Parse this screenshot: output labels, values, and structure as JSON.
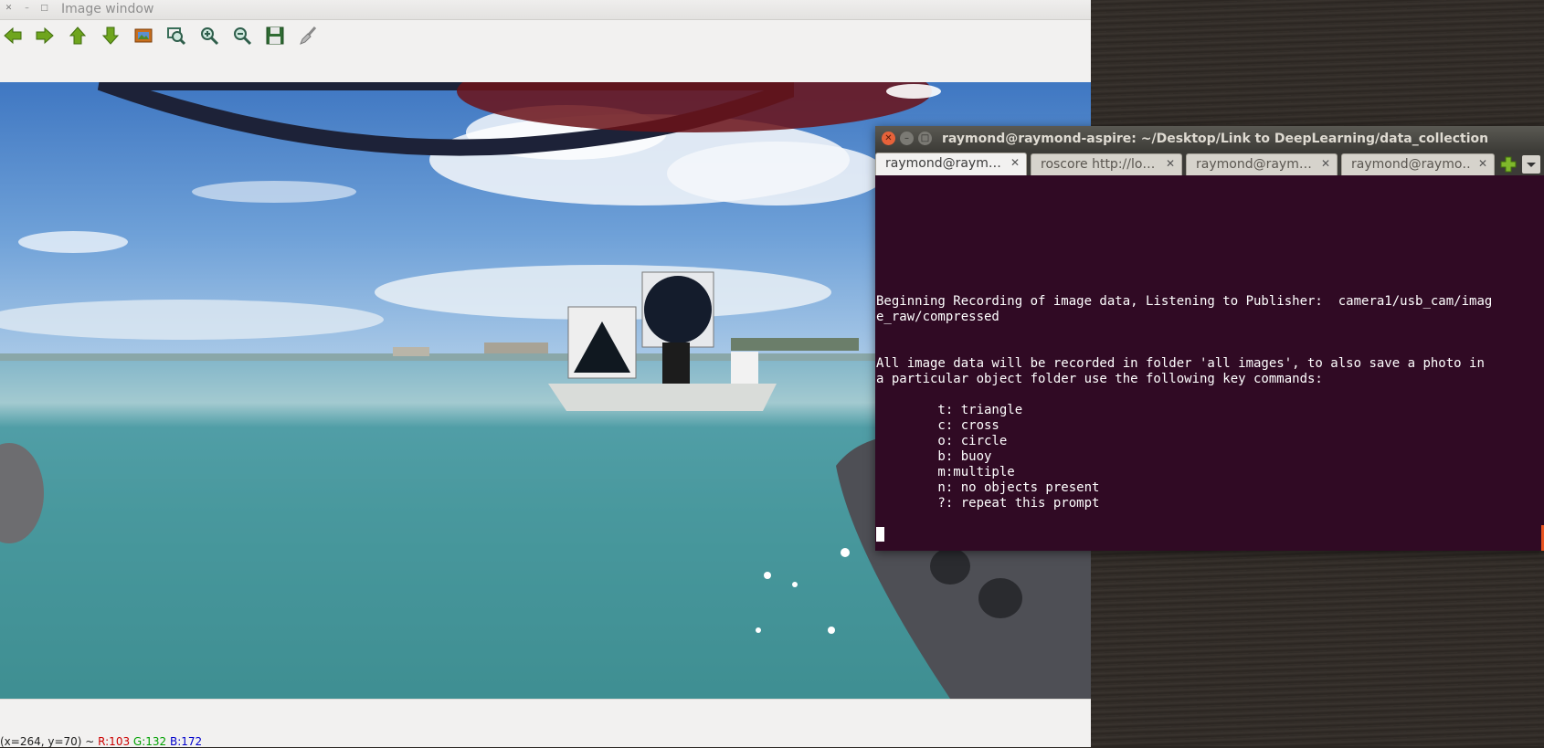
{
  "image_window": {
    "title": "Image window",
    "toolbar": [
      {
        "icon": "arrow-left-icon"
      },
      {
        "icon": "arrow-right-icon"
      },
      {
        "icon": "arrow-up-icon"
      },
      {
        "icon": "arrow-down-icon"
      },
      {
        "icon": "image-icon"
      },
      {
        "icon": "zoom-fit-icon"
      },
      {
        "icon": "zoom-in-icon"
      },
      {
        "icon": "zoom-out-icon"
      },
      {
        "icon": "save-icon"
      },
      {
        "icon": "brush-icon"
      }
    ],
    "status": {
      "coords": "(x=264, y=70) ~ ",
      "r": "R:103",
      "g": "G:132",
      "b": "B:172",
      "colors": {
        "r": "#cc0000",
        "g": "#00a000",
        "b": "#0000cc"
      }
    }
  },
  "terminal": {
    "title": "raymond@raymond-aspire: ~/Desktop/Link to DeepLearning/data_collection",
    "tabs": [
      {
        "label": "raymond@raym…",
        "active": true
      },
      {
        "label": "roscore http://lo…",
        "active": false
      },
      {
        "label": "raymond@raym…",
        "active": false
      },
      {
        "label": "raymond@raymo…",
        "active": false
      }
    ],
    "lines": {
      "l1": "Beginning Recording of image data, Listening to Publisher:  camera1/usb_cam/imag",
      "l2": "e_raw/compressed",
      "l3": "All image data will be recorded in folder 'all images', to also save a photo in",
      "l4": "a particular object folder use the following key commands:",
      "k1": "        t: triangle",
      "k2": "        c: cross",
      "k3": "        o: circle",
      "k4": "        b: buoy",
      "k5": "        m:multiple",
      "k6": "        n: no objects present",
      "k7": "        ?: repeat this prompt"
    },
    "colors": {
      "background": "#300a24",
      "text": "#ffffff",
      "accent": "#e95420"
    }
  }
}
